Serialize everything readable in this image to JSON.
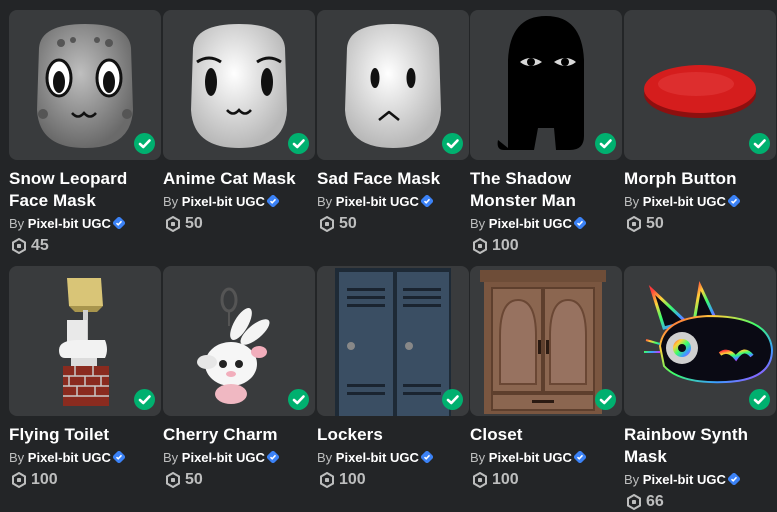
{
  "colors": {
    "background": "#232527",
    "card": "#393b3d",
    "owned_badge": "#00b06f",
    "verified_badge": "#3b82f6",
    "muted_text": "#bdbebe"
  },
  "items": [
    {
      "name": "Snow Leopard Face Mask",
      "by": "By",
      "creator": "Pixel-bit UGC",
      "price": "45",
      "icon": "snow-leopard-mask"
    },
    {
      "name": "Anime Cat Mask",
      "by": "By",
      "creator": "Pixel-bit UGC",
      "price": "50",
      "icon": "anime-cat-mask"
    },
    {
      "name": "Sad Face Mask",
      "by": "By",
      "creator": "Pixel-bit UGC",
      "price": "50",
      "icon": "sad-face-mask"
    },
    {
      "name": "The Shadow Monster Man",
      "by": "By",
      "creator": "Pixel-bit UGC",
      "price": "100",
      "icon": "shadow-monster"
    },
    {
      "name": "Morph Button",
      "by": "By",
      "creator": "Pixel-bit UGC",
      "price": "50",
      "icon": "red-button"
    },
    {
      "name": "Flying Toilet",
      "by": "By",
      "creator": "Pixel-bit UGC",
      "price": "100",
      "icon": "flying-toilet"
    },
    {
      "name": "Cherry Charm",
      "by": "By",
      "creator": "Pixel-bit UGC",
      "price": "50",
      "icon": "bunny-charm"
    },
    {
      "name": "Lockers",
      "by": "By",
      "creator": "Pixel-bit UGC",
      "price": "100",
      "icon": "lockers"
    },
    {
      "name": "Closet",
      "by": "By",
      "creator": "Pixel-bit UGC",
      "price": "100",
      "icon": "closet"
    },
    {
      "name": "Rainbow Synth Mask",
      "by": "By",
      "creator": "Pixel-bit UGC",
      "price": "66",
      "icon": "synth-mask"
    }
  ]
}
